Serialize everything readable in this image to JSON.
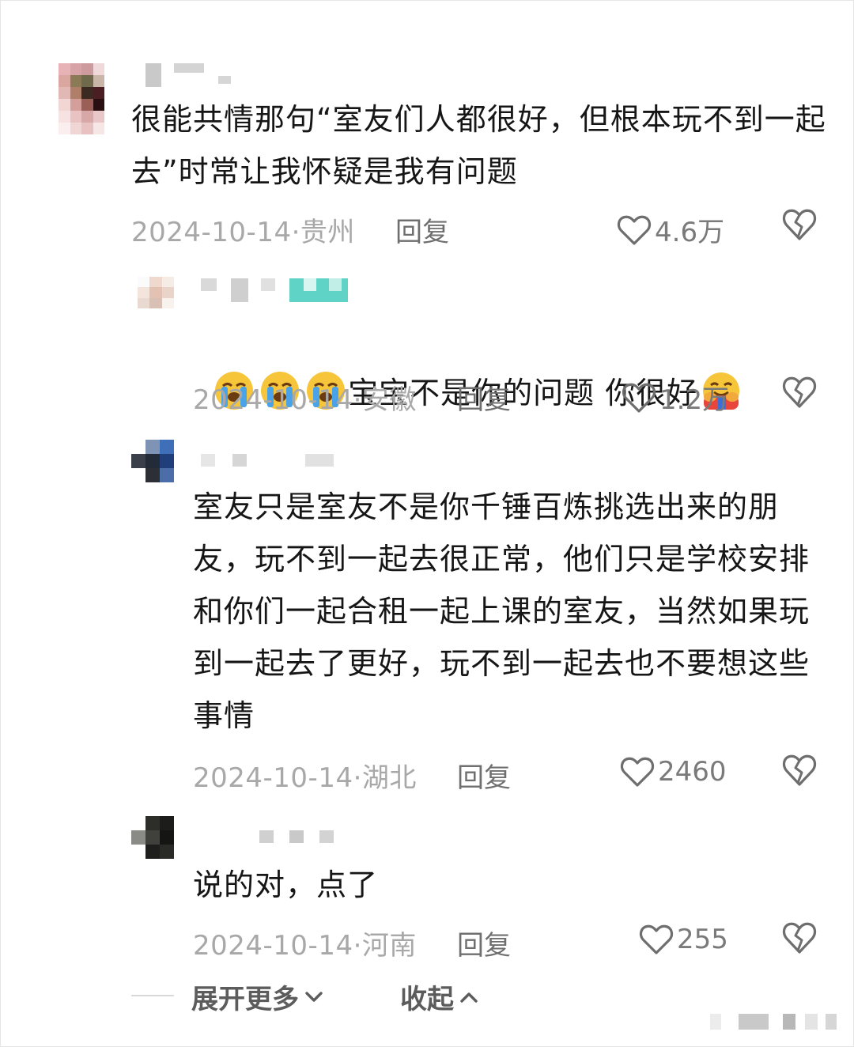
{
  "comments": [
    {
      "text": "很能共情那句“室友们人都很好，但根本玩不到一起去”时常让我怀疑是我有问题",
      "date": "2024-10-14",
      "location": "贵州",
      "reply_label": "回复",
      "likes": "4.6万"
    },
    {
      "text": "宝宝不是你的问题 你很好",
      "emoji_prefix": [
        "loudly-crying-face",
        "loudly-crying-face",
        "loudly-crying-face"
      ],
      "emoji_suffix": "hugging-face",
      "date": "2024-10-14",
      "location": "安徽",
      "reply_label": "回复",
      "likes": "1.2万"
    },
    {
      "text": "室友只是室友不是你千锤百炼挑选出来的朋友，玩不到一起去很正常，他们只是学校安排和你们一起合租一起上课的室友，当然如果玩到一起去了更好，玩不到一起去也不要想这些事情",
      "date": "2024-10-14",
      "location": "湖北",
      "reply_label": "回复",
      "likes": "2460"
    },
    {
      "text": "说的对，点了",
      "date": "2024-10-14",
      "location": "河南",
      "reply_label": "回复",
      "likes": "255"
    }
  ],
  "meta_separator": "·",
  "footer": {
    "expand_more": "展开更多",
    "collapse": "收起"
  },
  "colors": {
    "text": "#161616",
    "meta": "#a8a8a8",
    "reply": "#6f6f6f",
    "icon": "#6e6e6e"
  },
  "icons": {
    "like": "heart-outline-icon",
    "dislike": "broken-heart-icon",
    "expand": "chevron-down-icon",
    "collapse": "chevron-up-icon"
  }
}
